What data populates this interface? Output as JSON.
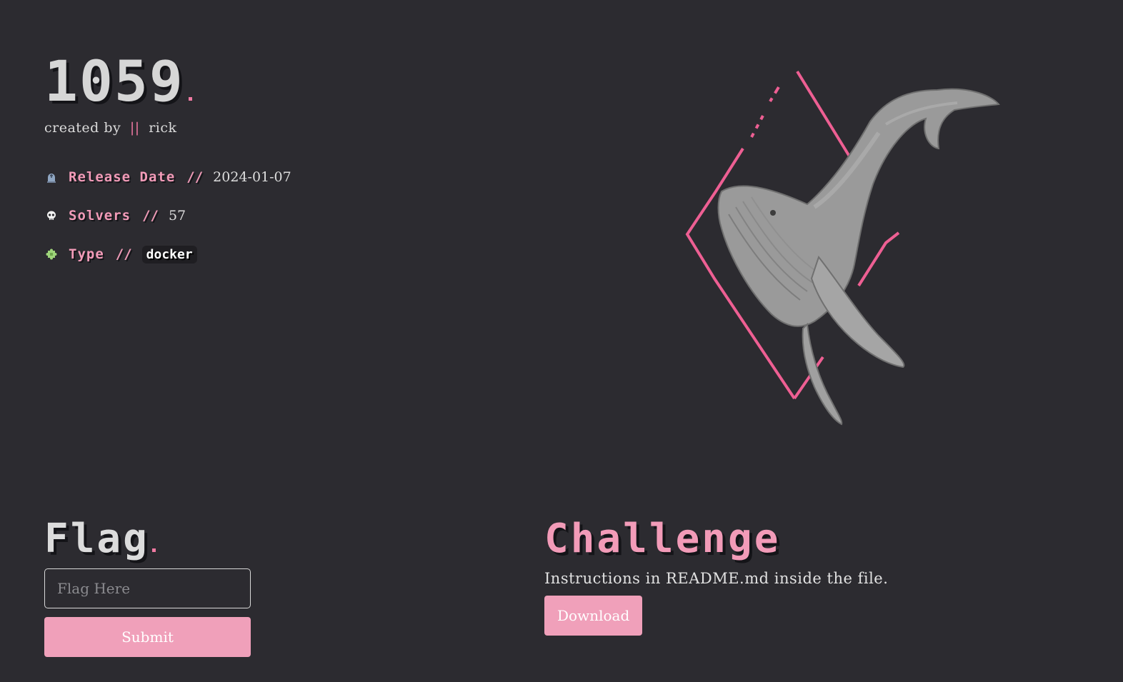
{
  "challenge": {
    "number": "1059",
    "created_by_prefix": "created by",
    "separator": "||",
    "author": "rick"
  },
  "meta": {
    "release": {
      "label": "Release Date",
      "slash": "//",
      "value": "2024-01-07",
      "icon": "tombstone-icon"
    },
    "solvers": {
      "label": "Solvers",
      "slash": "//",
      "value": "57",
      "icon": "skull-icon"
    },
    "type": {
      "label": "Type",
      "slash": "//",
      "value": "docker",
      "icon": "puzzle-icon"
    }
  },
  "flag": {
    "heading": "Flag",
    "input_value": "",
    "placeholder": "Flag Here",
    "submit_label": "Submit"
  },
  "challenge_section": {
    "heading": "Challenge",
    "instructions": "Instructions in README.md inside the file.",
    "download_label": "Download"
  },
  "colors": {
    "background": "#2c2b30",
    "accent_pink": "#f07aa2",
    "button_pink": "#f0a0ba",
    "text_light": "#dcdcdc"
  }
}
